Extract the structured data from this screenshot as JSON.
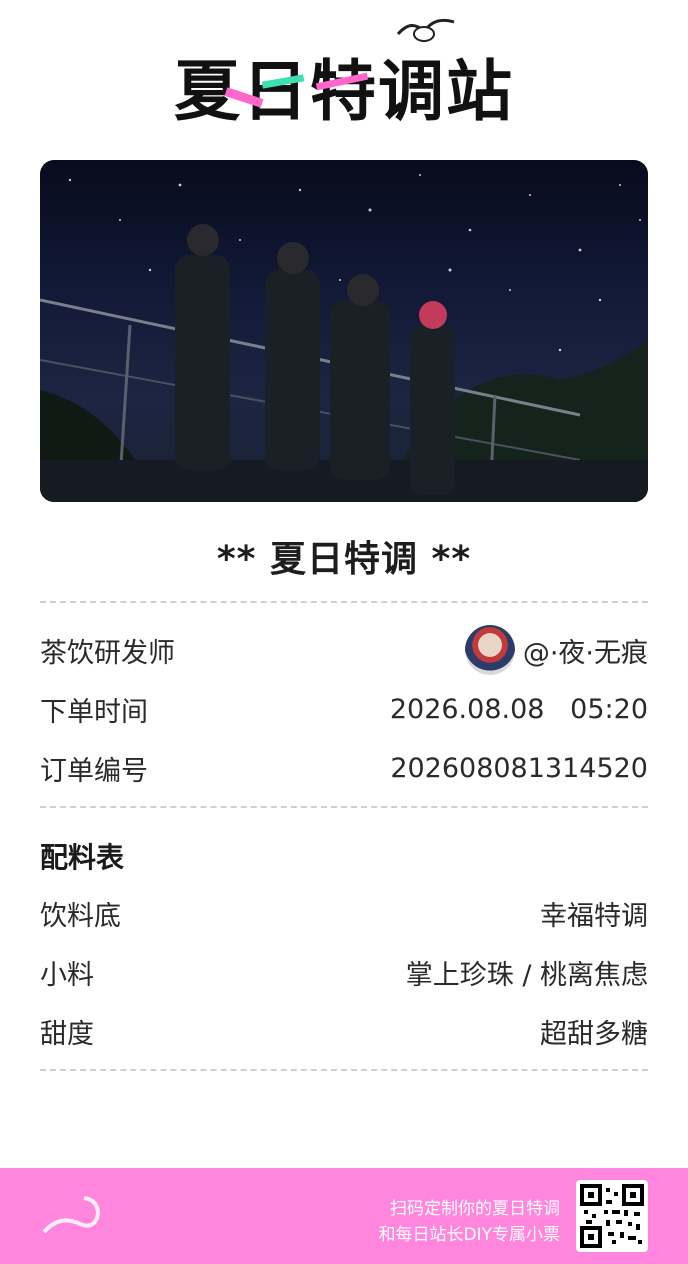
{
  "header": {
    "logo_text": "夏日特调站"
  },
  "hero": {
    "image_desc": "night-sky-characters-image"
  },
  "ticket": {
    "title": "** 夏日特调 **",
    "rows": [
      {
        "label": "茶饮研发师",
        "value": "@·夜·无痕"
      },
      {
        "label": "下单时间",
        "value": "2026.08.08   05:20"
      },
      {
        "label": "订单编号",
        "value": "202608081314520"
      }
    ],
    "recipe_heading": "配料表",
    "recipe": [
      {
        "label": "饮料底",
        "value": "幸福特调"
      },
      {
        "label": "小料",
        "value": "掌上珍珠 / 桃离焦虑"
      },
      {
        "label": "甜度",
        "value": "超甜多糖"
      }
    ]
  },
  "footer": {
    "line1": "扫码定制你的夏日特调",
    "line2": "和每日站长DIY专属小票",
    "bg_color": "#ff86dc"
  },
  "colors": {
    "pink": "#ff66cc",
    "green": "#3fe0b0"
  }
}
